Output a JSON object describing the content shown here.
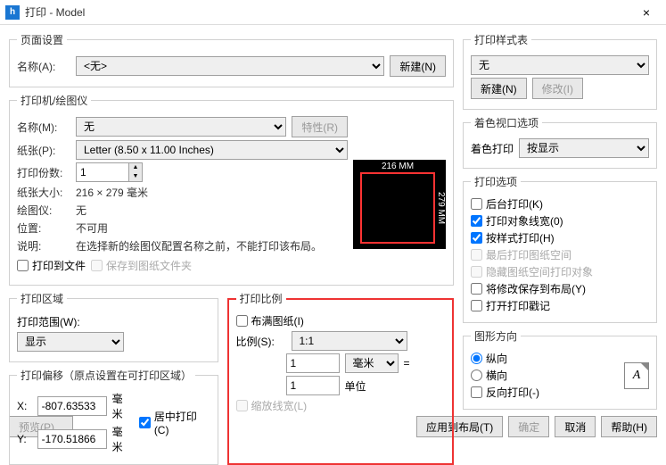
{
  "window": {
    "title": "打印 - Model",
    "close": "×",
    "icon": "h"
  },
  "page_setup": {
    "legend": "页面设置",
    "name_label": "名称(A):",
    "name_value": "<无>",
    "new_btn": "新建(N)"
  },
  "printer": {
    "legend": "打印机/绘图仪",
    "name_label": "名称(M):",
    "name_value": "无",
    "props_btn": "特性(R)",
    "paper_label": "纸张(P):",
    "paper_value": "Letter (8.50 x 11.00 Inches)",
    "copies_label": "打印份数:",
    "copies_value": "1",
    "size_label": "纸张大小:",
    "size_value": "216 × 279  毫米",
    "plotter_label": "绘图仪:",
    "plotter_value": "无",
    "location_label": "位置:",
    "location_value": "不可用",
    "desc_label": "说明:",
    "desc_value": "在选择新的绘图仪配置名称之前，不能打印该布局。",
    "to_file": "打印到文件",
    "save_to_folder": "保存到图纸文件夹",
    "preview_w": "216 MM",
    "preview_h": "279 MM"
  },
  "area": {
    "legend": "打印区域",
    "range_label": "打印范围(W):",
    "range_value": "显示"
  },
  "scale": {
    "legend": "打印比例",
    "fit": "布满图纸(I)",
    "ratio_label": "比例(S):",
    "ratio_value": "1:1",
    "num1": "1",
    "unit_mm": "毫米",
    "eq": "=",
    "num2": "1",
    "unit_u": "单位",
    "scale_lw": "缩放线宽(L)"
  },
  "offset": {
    "legend": "打印偏移（原点设置在可打印区域）",
    "x_label": "X:",
    "x_value": "-807.63533",
    "y_label": "Y:",
    "y_value": "-170.51866",
    "unit": "毫米",
    "center": "居中打印(C)"
  },
  "style": {
    "legend": "打印样式表",
    "value": "无",
    "new_btn": "新建(N)",
    "edit_btn": "修改(I)"
  },
  "shaded": {
    "legend": "着色视口选项",
    "label": "着色打印",
    "value": "按显示"
  },
  "options": {
    "legend": "打印选项",
    "bg": "后台打印(K)",
    "lw": "打印对象线宽(0)",
    "style": "按样式打印(H)",
    "last": "最后打印图纸空间",
    "hide": "隐藏图纸空间打印对象",
    "save": "将修改保存到布局(Y)",
    "stamp": "打开打印戳记"
  },
  "orient": {
    "legend": "图形方向",
    "portrait": "纵向",
    "landscape": "横向",
    "reverse": "反向打印(-)"
  },
  "bottom": {
    "preview": "预览(P)...",
    "apply": "应用到布局(T)",
    "ok": "确定",
    "cancel": "取消",
    "help": "帮助(H)"
  }
}
